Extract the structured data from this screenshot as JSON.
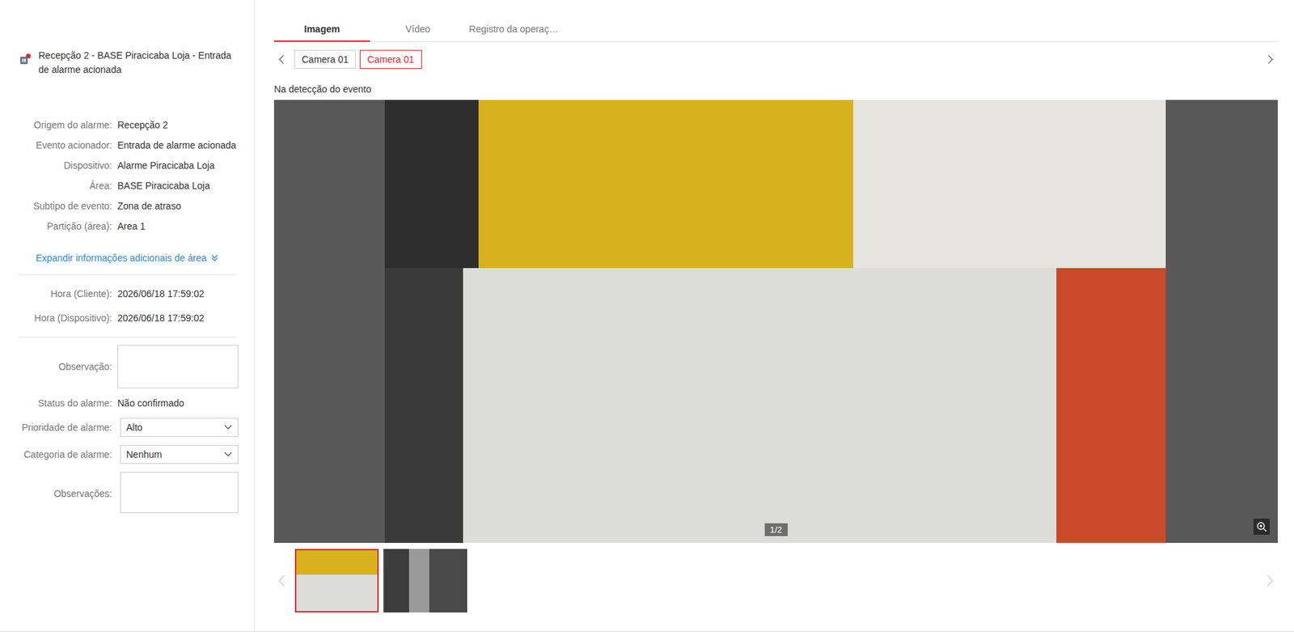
{
  "alarm": {
    "title": "Recepção 2 - BASE Piracicaba Loja - Entrada de alarme acionada",
    "unread": true
  },
  "details": [
    {
      "label": "Origem do alarme:",
      "value": "Recepção 2"
    },
    {
      "label": "Evento acionador:",
      "value": "Entrada de alarme acionada"
    },
    {
      "label": "Dispositivo:",
      "value": "Alarme Piracicaba Loja"
    },
    {
      "label": "Área:",
      "value": "BASE Piracicaba Loja"
    },
    {
      "label": "Subtipo de evento:",
      "value": "Zona de atraso"
    },
    {
      "label": "Partição (área):",
      "value": "Area 1"
    }
  ],
  "expand_link": "Expandir informações adicionais de área",
  "times": [
    {
      "label": "Hora (Cliente):",
      "value": "2026/06/18 17:59:02"
    },
    {
      "label": "Hora (Dispositivo):",
      "value": "2026/06/18 17:59:02"
    }
  ],
  "observacao": {
    "label": "Observação:",
    "value": ""
  },
  "status": {
    "label": "Status do alarme:",
    "value": "Não confirmado"
  },
  "priority": {
    "label": "Prioridade de alarme:",
    "value": "Alto"
  },
  "category": {
    "label": "Categoria de alarme:",
    "value": "Nenhum"
  },
  "observacoes": {
    "label": "Observações:",
    "value": ""
  },
  "tabs": [
    {
      "label": "Imagem",
      "selected": true
    },
    {
      "label": "Vídeo",
      "selected": false
    },
    {
      "label": "Registro da operaç…",
      "selected": false
    }
  ],
  "cameras": [
    {
      "label": "Camera 01",
      "selected": false
    },
    {
      "label": "Camera 01",
      "selected": true
    }
  ],
  "caption": "Na detecção do evento",
  "counter": "1/2",
  "thumbnails": [
    {
      "selected": true
    },
    {
      "selected": false
    }
  ]
}
